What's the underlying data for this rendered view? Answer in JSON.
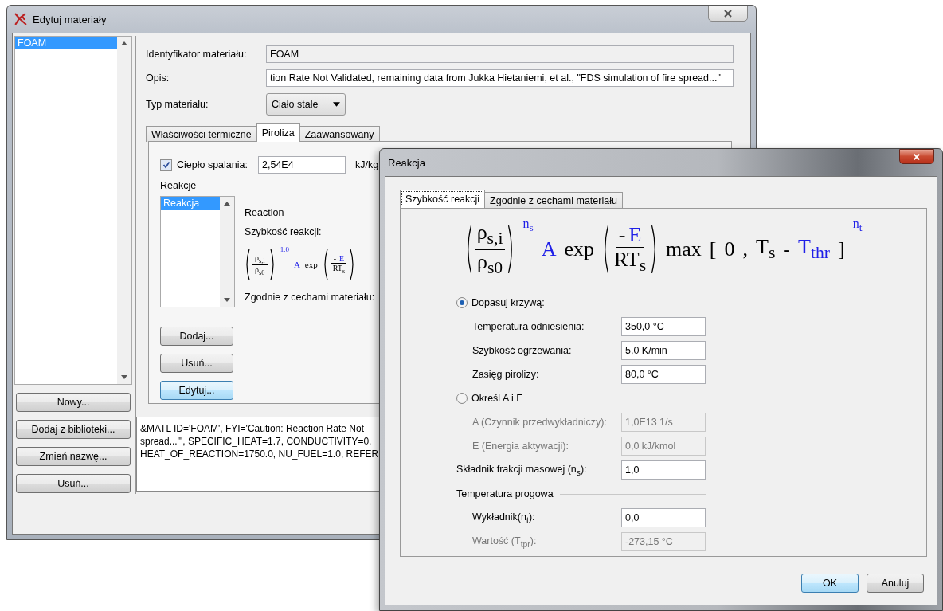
{
  "window": {
    "title": "Edytuj materiały"
  },
  "materials": [
    {
      "label": "FOAM",
      "selected": true
    }
  ],
  "side_buttons": [
    "Nowy...",
    "Dodaj z biblioteki...",
    "Zmień nazwę...",
    "Usuń..."
  ],
  "form": {
    "id_label": "Identyfikator materiału:",
    "id_value": "FOAM",
    "desc_label": "Opis:",
    "desc_value": "tion Rate Not Validated, remaining data from Jukka Hietaniemi, et al., \"FDS simulation of fire spread...\"",
    "type_label": "Typ materiału:",
    "type_value": "Ciało stałe"
  },
  "tabs": [
    {
      "label": "Właściwości termiczne",
      "selected": false
    },
    {
      "label": "Piroliza",
      "selected": true
    },
    {
      "label": "Zaawansowany",
      "selected": false
    }
  ],
  "pyrolysis": {
    "heat_checked": true,
    "heat_label": "Ciepło spalania:",
    "heat_value": "2,54E4",
    "heat_unit": "kJ/kg",
    "reactions_label": "Reakcje",
    "reactions": [
      {
        "label": "Reakcja",
        "selected": true
      }
    ],
    "reaction_name": "Reaction",
    "rate_label": "Szybkość reakcji:",
    "formula": [
      {
        "kind": "frac",
        "num": [
          {
            "text": "ρ$_{s,i}$",
            "highlight": false
          }
        ],
        "den": [
          {
            "text": "ρ$_{s0}$",
            "highlight": false
          }
        ]
      },
      {
        "kind": "sup",
        "text": "1.0",
        "highlight": true
      },
      {
        "kind": "token",
        "text": "A",
        "highlight": true
      },
      {
        "kind": "token",
        "text": "exp",
        "highlight": false
      },
      {
        "kind": "frac",
        "num": [
          {
            "text": "-",
            "highlight": false
          },
          {
            "text": "E",
            "highlight": true
          }
        ],
        "den": [
          {
            "text": "RT$_{s}$",
            "highlight": false
          }
        ]
      }
    ],
    "material_label": "Zgodnie z cechami materiału:",
    "buttons": [
      {
        "label": "Dodaj...",
        "focused": false
      },
      {
        "label": "Usuń...",
        "focused": false
      },
      {
        "label": "Edytuj...",
        "focused": true
      }
    ]
  },
  "output": [
    "&MATL ID='FOAM', FYI='Caution: Reaction Rate Not",
    "spread...\"', SPECIFIC_HEAT=1.7, CONDUCTIVITY=0.",
    "HEAT_OF_REACTION=1750.0, NU_FUEL=1.0, REFER"
  ],
  "dialog": {
    "title": "Reakcja",
    "tabs": [
      {
        "label": "Szybkość reakcji",
        "selected": true
      },
      {
        "label": "Zgodnie z cechami materiału",
        "selected": false
      }
    ],
    "formula": [
      {
        "kind": "frac",
        "num": [
          {
            "text": "ρ$_{s,i}$",
            "highlight": false
          }
        ],
        "den": [
          {
            "text": "ρ$_{s0}$",
            "highlight": false
          }
        ]
      },
      {
        "kind": "sup",
        "text": "n$_{s}$",
        "highlight": true
      },
      {
        "kind": "token",
        "text": "A",
        "highlight": true
      },
      {
        "kind": "token",
        "text": "exp",
        "highlight": false
      },
      {
        "kind": "frac",
        "num": [
          {
            "text": "-",
            "highlight": false
          },
          {
            "text": "E",
            "highlight": true
          }
        ],
        "den": [
          {
            "text": "RT$_{s}$",
            "highlight": false
          }
        ]
      },
      {
        "kind": "token",
        "text": "max",
        "highlight": false
      },
      {
        "kind": "token",
        "text": "[",
        "highlight": false
      },
      {
        "kind": "token",
        "text": "0",
        "highlight": false
      },
      {
        "kind": "token",
        "text": ",",
        "highlight": false
      },
      {
        "kind": "token",
        "text": "T$_{s}$",
        "highlight": false
      },
      {
        "kind": "token",
        "text": "-",
        "highlight": false
      },
      {
        "kind": "token",
        "text": "T$_{thr}$",
        "highlight": true
      },
      {
        "kind": "token",
        "text": "]",
        "highlight": false
      },
      {
        "kind": "sup",
        "text": "n$_{t}$",
        "highlight": true
      }
    ],
    "rows": [
      {
        "kind": "radio",
        "label": "Dopasuj krzywą:",
        "selected": true,
        "children": [
          {
            "label": "Temperatura odniesienia:",
            "value": "350,0 °C",
            "disabled": false
          },
          {
            "label": "Szybkość ogrzewania:",
            "value": "5,0 K/min",
            "disabled": false
          },
          {
            "label": "Zasięg pirolizy:",
            "value": "80,0 °C",
            "disabled": false
          }
        ]
      },
      {
        "kind": "radio",
        "label": "Określ A i E",
        "selected": false,
        "children": [
          {
            "label": "A (Czynnik przedwykładniczy):",
            "value": "1,0E13 1/s",
            "disabled": true
          },
          {
            "label": "E (Energia aktywacji):",
            "value": "0,0 kJ/kmol",
            "disabled": true
          }
        ]
      },
      {
        "kind": "field",
        "label": "Składnik frakcji masowej (n$_{s}$):",
        "value": "1,0",
        "disabled": false
      },
      {
        "kind": "group",
        "label": "Temperatura progowa",
        "children": [
          {
            "label": "Wykładnik(n$_{t}$):",
            "value": "0,0",
            "disabled": false
          },
          {
            "label": "Wartość (T$_{tpr}$):",
            "value": "-273,15 °C",
            "disabled": true
          }
        ]
      }
    ],
    "buttons": [
      {
        "label": "OK",
        "default": true
      },
      {
        "label": "Anuluj",
        "default": false
      }
    ]
  }
}
